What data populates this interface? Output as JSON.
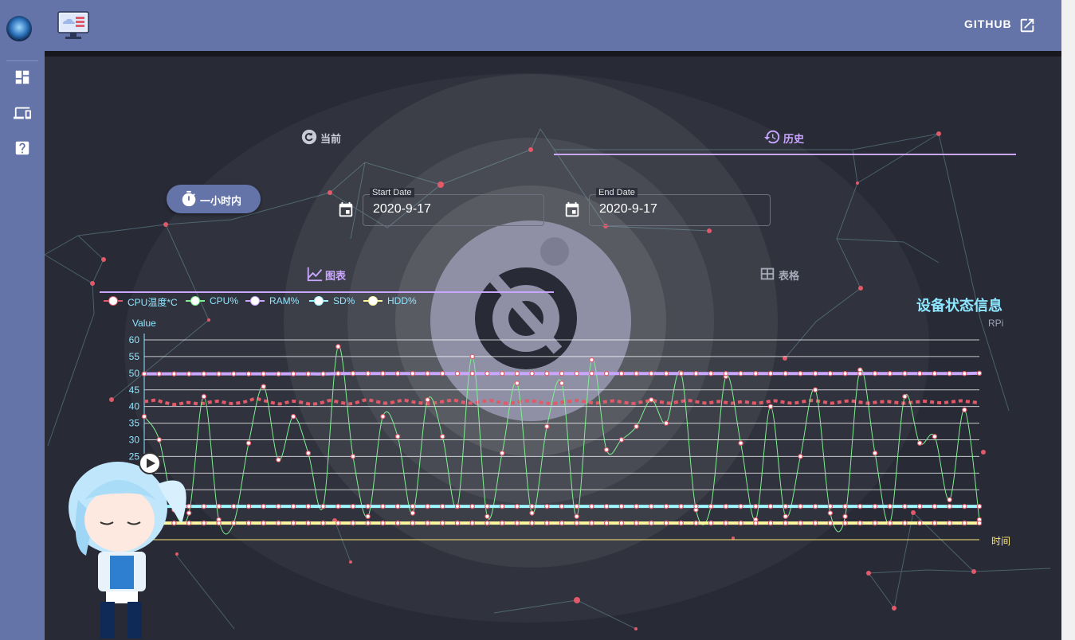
{
  "header": {
    "github_label": "GITHUB"
  },
  "tabs": {
    "current": "当前",
    "history": "历史",
    "chart": "图表",
    "table": "表格"
  },
  "controls": {
    "hour_button": "一小时内",
    "start_date_label": "Start Date",
    "start_date_value": "2020-9-17",
    "end_date_label": "End Date",
    "end_date_value": "2020-9-17"
  },
  "status": {
    "title": "设备状态信息",
    "subtitle": "RPi"
  },
  "icons": {
    "sidebar": [
      "dashboard-icon",
      "devices-icon",
      "help-icon"
    ],
    "tabs": [
      "refresh-icon",
      "history-icon",
      "chart-icon",
      "table-icon"
    ]
  },
  "colors": {
    "accent": "#6474a8",
    "tab_underline": "#c9a6ff",
    "chart_text": "#8ee6ff"
  },
  "chart_data": {
    "type": "line",
    "ylabel": "Value",
    "xlabel": "时间",
    "ylim": [
      0,
      60
    ],
    "yticks": [
      0,
      5,
      10,
      15,
      20,
      25,
      30,
      35,
      40,
      45,
      50,
      55,
      60
    ],
    "series": [
      {
        "name": "CPU温度*C",
        "color": "#e05a6a",
        "values": [
          41.5,
          41.7,
          41.9,
          41.3,
          40.9,
          40.6,
          40.9,
          41.2,
          41.0,
          40.8,
          41.1,
          41.4,
          41.6,
          41.2,
          40.9,
          41.0,
          41.3,
          41.8,
          42.4,
          41.9,
          41.5,
          41.0,
          40.8,
          41.2,
          41.6,
          41.4,
          41.0,
          40.7,
          40.9,
          41.3,
          41.8,
          41.5,
          41.1,
          40.8,
          41.0,
          41.6,
          42.0,
          41.7,
          41.3,
          41.0,
          41.2,
          41.6,
          41.9,
          41.5,
          41.2,
          41.0,
          40.8,
          41.1,
          41.4,
          41.7,
          41.9,
          41.5,
          41.1,
          41.0,
          41.3,
          41.6,
          41.8,
          41.4,
          41.1,
          40.9,
          41.2,
          41.5,
          41.7,
          41.6,
          41.3,
          41.0,
          40.8,
          41.1,
          41.4,
          41.6,
          41.8,
          41.5,
          41.2,
          41.0,
          41.3,
          41.5,
          41.7,
          41.4,
          41.1,
          40.9,
          41.2,
          41.5,
          41.8,
          41.5,
          41.2,
          41.0,
          41.3,
          41.6,
          41.8,
          41.5,
          41.2,
          41.0,
          41.3,
          41.5,
          41.2,
          41.0,
          41.3,
          41.4,
          41.1,
          41.0,
          41.2,
          41.5,
          41.7,
          41.4,
          41.1,
          41.0,
          41.3,
          41.6,
          41.8,
          41.6,
          41.3,
          41.0,
          41.2,
          41.5,
          41.7,
          41.5,
          41.2,
          41.0,
          41.2,
          41.4,
          41.5,
          41.3,
          41.1,
          41.0,
          41.2,
          41.4,
          41.6,
          41.4,
          41.2,
          41.1,
          41.3,
          41.5,
          41.7,
          41.5,
          41.3,
          41.1
        ]
      },
      {
        "name": "CPU%",
        "color": "#7ef08f",
        "values": [
          37,
          30,
          9,
          8,
          43,
          6,
          5,
          29,
          46,
          24,
          37,
          26,
          10,
          58,
          25,
          7,
          37,
          31,
          8,
          42,
          31,
          10,
          55,
          7,
          26,
          47,
          8,
          34,
          47,
          7,
          54,
          27,
          30,
          34,
          42,
          35,
          50,
          9,
          10,
          49,
          29,
          6,
          40,
          7,
          25,
          45,
          8,
          7,
          51,
          26,
          5,
          43,
          29,
          31,
          12,
          39,
          6
        ]
      },
      {
        "name": "RAM%",
        "color": "#c9a6ff",
        "values": [
          49.8,
          49.8,
          49.8,
          49.8,
          49.8,
          49.8,
          49.8,
          49.8,
          49.8,
          49.8,
          49.8,
          49.8,
          49.8,
          49.9,
          49.9,
          49.9,
          49.9,
          49.9,
          49.9,
          49.9,
          49.9,
          49.9,
          49.9,
          49.9,
          49.9,
          49.9,
          49.9,
          49.9,
          49.9,
          49.9,
          49.9,
          49.9,
          49.9,
          49.9,
          49.9,
          49.9,
          49.9,
          49.9,
          49.9,
          49.9,
          49.9,
          49.9,
          49.9,
          49.9,
          49.9,
          49.9,
          49.9,
          49.9,
          49.9,
          49.9,
          49.9,
          49.9,
          49.9,
          49.9,
          49.9,
          49.9,
          50.0
        ]
      },
      {
        "name": "SD%",
        "color": "#9ff6ff",
        "values": [
          10,
          10,
          10,
          10,
          10,
          10,
          10,
          10,
          10,
          10,
          10,
          10,
          10,
          10,
          10,
          10,
          10,
          10,
          10,
          10,
          10,
          10,
          10,
          10,
          10,
          10,
          10,
          10,
          10,
          10,
          10,
          10,
          10,
          10,
          10,
          10,
          10,
          10,
          10,
          10,
          10,
          10,
          10,
          10,
          10,
          10,
          10,
          10,
          10,
          10,
          10,
          10,
          10,
          10,
          10,
          10,
          10
        ]
      },
      {
        "name": "HDD%",
        "color": "#fff6a0",
        "values": [
          5,
          5,
          5,
          5,
          5,
          5,
          5,
          5,
          5,
          5,
          5,
          5,
          5,
          5,
          5,
          5,
          5,
          5,
          5,
          5,
          5,
          5,
          5,
          5,
          5,
          5,
          5,
          5,
          5,
          5,
          5,
          5,
          5,
          5,
          5,
          5,
          5,
          5,
          5,
          5,
          5,
          5,
          5,
          5,
          5,
          5,
          5,
          5,
          5,
          5,
          5,
          5,
          5,
          5,
          5,
          5,
          5
        ]
      }
    ]
  }
}
